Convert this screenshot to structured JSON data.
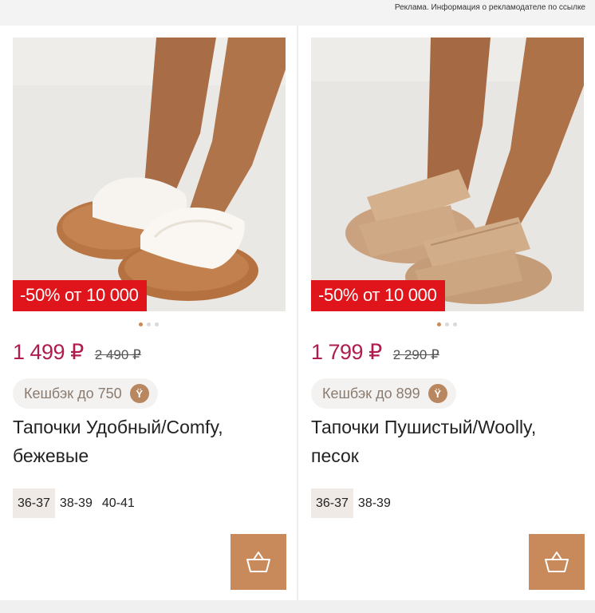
{
  "ad_notice": "Реклама. Информация о рекламодателе по ссылке",
  "colors": {
    "promo_bg": "#e0141b",
    "price": "#b01c4f",
    "accent": "#c88a5a"
  },
  "products": [
    {
      "promo": "-50% от 10 000",
      "price": "1 499 ₽",
      "old_price": "2 490 ₽",
      "cashback": "Кешбэк до 750",
      "cashback_icon": "Ÿ",
      "title": "Тапочки Удобный/Comfy, бежевые",
      "sizes": [
        "36-37",
        "38-39",
        "40-41"
      ],
      "selected_size": "36-37",
      "image_dots": 3,
      "active_dot": 1
    },
    {
      "promo": "-50% от 10 000",
      "price": "1 799 ₽",
      "old_price": "2 290 ₽",
      "cashback": "Кешбэк до 899",
      "cashback_icon": "Ÿ",
      "title": "Тапочки Пушистый/Woolly, песок",
      "sizes": [
        "36-37",
        "38-39"
      ],
      "selected_size": "36-37",
      "image_dots": 3,
      "active_dot": 1
    }
  ]
}
